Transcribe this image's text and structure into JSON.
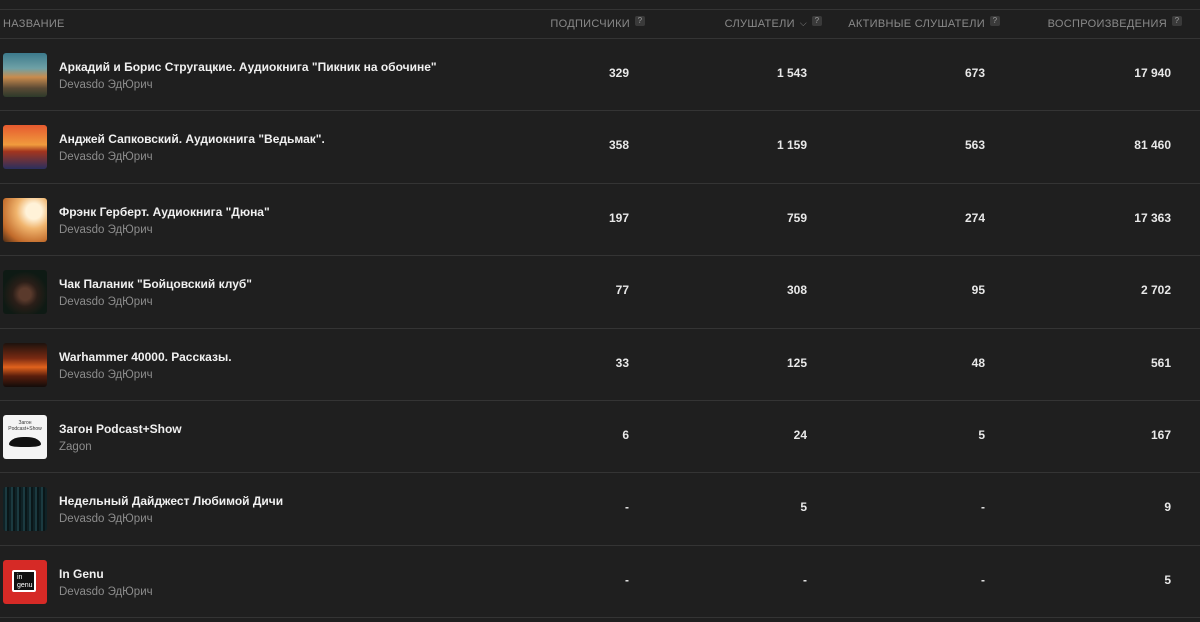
{
  "header": {
    "name": "НАЗВАНИЕ",
    "subscribers": "ПОДПИСЧИКИ",
    "listeners": "СЛУШАТЕЛИ",
    "active_listeners": "АКТИВНЫЕ СЛУШАТЕЛИ",
    "plays": "ВОСПРОИЗВЕДЕНИЯ",
    "help_glyph": "?",
    "sort_glyph": "⌵"
  },
  "rows": [
    {
      "title": "Аркадий и Борис Стругацкие. Аудиокнига \"Пикник на обочине\"",
      "author": "Devasdo ЭдЮрич",
      "subscribers": "329",
      "listeners": "1 543",
      "active": "673",
      "plays": "17 940"
    },
    {
      "title": "Анджей Сапковский. Аудиокнига \"Ведьмак\".",
      "author": "Devasdo ЭдЮрич",
      "subscribers": "358",
      "listeners": "1 159",
      "active": "563",
      "plays": "81 460"
    },
    {
      "title": "Фрэнк Герберт. Аудиокнига \"Дюна\"",
      "author": "Devasdo ЭдЮрич",
      "subscribers": "197",
      "listeners": "759",
      "active": "274",
      "plays": "17 363"
    },
    {
      "title": "Чак Паланик \"Бойцовский клуб\"",
      "author": "Devasdo ЭдЮрич",
      "subscribers": "77",
      "listeners": "308",
      "active": "95",
      "plays": "2 702"
    },
    {
      "title": "Warhammer 40000. Рассказы.",
      "author": "Devasdo ЭдЮрич",
      "subscribers": "33",
      "listeners": "125",
      "active": "48",
      "plays": "561"
    },
    {
      "title": "Загон Podcast+Show",
      "author": "Zagon",
      "subscribers": "6",
      "listeners": "24",
      "active": "5",
      "plays": "167",
      "cover_text": "Загон Podcast+Show"
    },
    {
      "title": "Недельный Дайджест Любимой Дичи",
      "author": "Devasdo ЭдЮрич",
      "subscribers": "-",
      "listeners": "5",
      "active": "-",
      "plays": "9"
    },
    {
      "title": "In Genu",
      "author": "Devasdo ЭдЮрич",
      "subscribers": "-",
      "listeners": "-",
      "active": "-",
      "plays": "5",
      "cover_text": "in genu"
    }
  ]
}
